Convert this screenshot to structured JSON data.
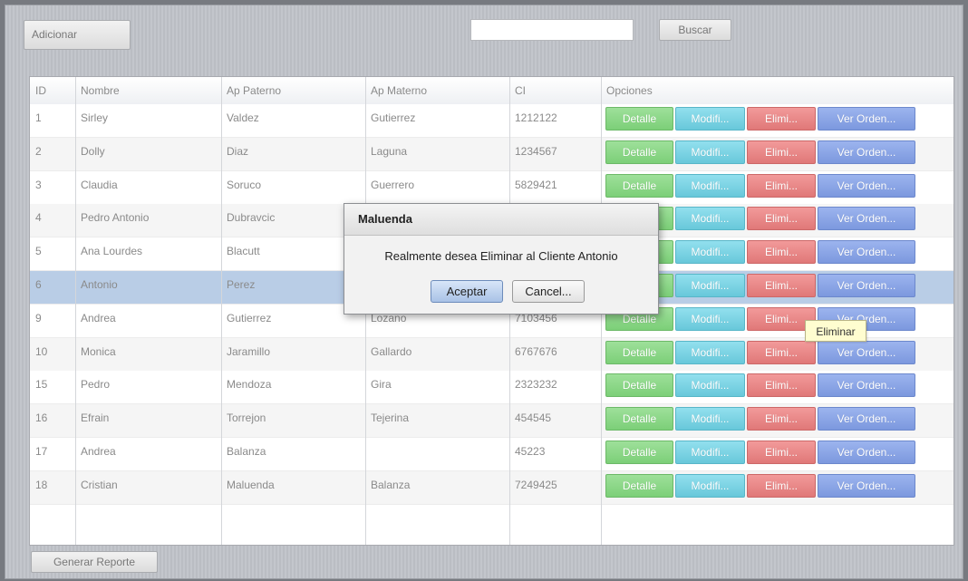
{
  "toolbar": {
    "add_label": "Adicionar",
    "search_value": "",
    "search_label": "Buscar"
  },
  "table": {
    "headers": [
      "ID",
      "Nombre",
      "Ap Paterno",
      "Ap Materno",
      "CI",
      "Opciones"
    ],
    "rows": [
      {
        "id": "1",
        "nombre": "Sirley",
        "paterno": "Valdez",
        "materno": "Gutierrez",
        "ci": "1212122"
      },
      {
        "id": "2",
        "nombre": "Dolly",
        "paterno": "Diaz",
        "materno": "Laguna",
        "ci": "1234567"
      },
      {
        "id": "3",
        "nombre": "Claudia",
        "paterno": "Soruco",
        "materno": "Guerrero",
        "ci": "5829421"
      },
      {
        "id": "4",
        "nombre": "Pedro Antonio",
        "paterno": "Dubravcic",
        "materno": "",
        "ci": ""
      },
      {
        "id": "5",
        "nombre": "Ana Lourdes",
        "paterno": "Blacutt",
        "materno": "",
        "ci": ""
      },
      {
        "id": "6",
        "nombre": "Antonio",
        "paterno": "Perez",
        "materno": "",
        "ci": ""
      },
      {
        "id": "9",
        "nombre": "Andrea",
        "paterno": "Gutierrez",
        "materno": "Lozano",
        "ci": "7103456"
      },
      {
        "id": "10",
        "nombre": "Monica",
        "paterno": "Jaramillo",
        "materno": "Gallardo",
        "ci": "6767676"
      },
      {
        "id": "15",
        "nombre": "Pedro",
        "paterno": "Mendoza",
        "materno": "Gira",
        "ci": "2323232"
      },
      {
        "id": "16",
        "nombre": "Efrain",
        "paterno": "Torrejon",
        "materno": "Tejerina",
        "ci": "454545"
      },
      {
        "id": "17",
        "nombre": "Andrea",
        "paterno": "Balanza",
        "materno": "",
        "ci": "45223"
      },
      {
        "id": "18",
        "nombre": "Cristian",
        "paterno": "Maluenda",
        "materno": "Balanza",
        "ci": "7249425"
      }
    ],
    "option_labels": {
      "detail": "Detalle",
      "modify": "Modifi...",
      "delete": "Elimi...",
      "orders": "Ver Orden..."
    },
    "selected_row_id": "6"
  },
  "dialog": {
    "title": "Maluenda",
    "message": "Realmente desea Eliminar al Cliente Antonio",
    "accept_label": "Aceptar",
    "cancel_label": "Cancel..."
  },
  "tooltip": {
    "text": "Eliminar"
  },
  "footer": {
    "report_label": "Generar Reporte"
  },
  "colors": {
    "detail": "#7ccf78",
    "modify": "#68c8da",
    "delete": "#e07878",
    "orders": "#7c98de",
    "selected_row": "#b9cde6"
  }
}
